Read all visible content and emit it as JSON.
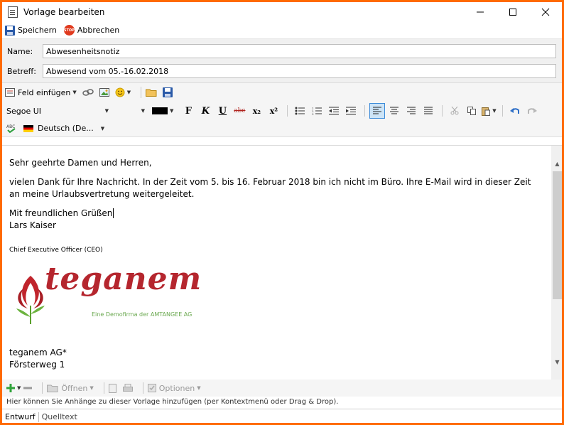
{
  "window": {
    "title": "Vorlage bearbeiten"
  },
  "actions": {
    "save": "Speichern",
    "cancel": "Abbrechen",
    "stop_badge": "STOP"
  },
  "fields": {
    "name_label": "Name:",
    "name_value": "Abwesenheitsnotiz",
    "subject_label": "Betreff:",
    "subject_value": "Abwesend vom 05.-16.02.2018"
  },
  "toolbar": {
    "insert_field": "Feld einfügen"
  },
  "format": {
    "font": "Segoe UI",
    "bold": "F",
    "italic": "K",
    "underline": "U",
    "strike": "abc",
    "sub": "x₂",
    "sup": "x²"
  },
  "spell": {
    "language": "Deutsch (De...",
    "abc": "ABC"
  },
  "editor": {
    "greeting": "Sehr geehrte Damen und Herren,",
    "body": "vielen Dank für Ihre Nachricht. In der Zeit vom 5. bis 16. Februar 2018 bin ich nicht im Büro. Ihre E-Mail wird in dieser Zeit an meine Urlaubsvertretung weitergeleitet.",
    "closing": "Mit freundlichen Grüßen",
    "signature_name": "Lars Kaiser",
    "role": "Chief Executive Officer (CEO)",
    "logo_text": "teganem",
    "logo_tagline": "Eine Demofirma der AMTANGEE AG",
    "company": "teganem AG*",
    "street": "Försterweg 1"
  },
  "attachments": {
    "open": "Öffnen",
    "options": "Optionen"
  },
  "hint": "Hier können Sie Anhänge zu dieser Vorlage hinzufügen (per Kontextmenü oder Drag & Drop).",
  "tabs": {
    "draft": "Entwurf",
    "source": "Quelltext"
  }
}
